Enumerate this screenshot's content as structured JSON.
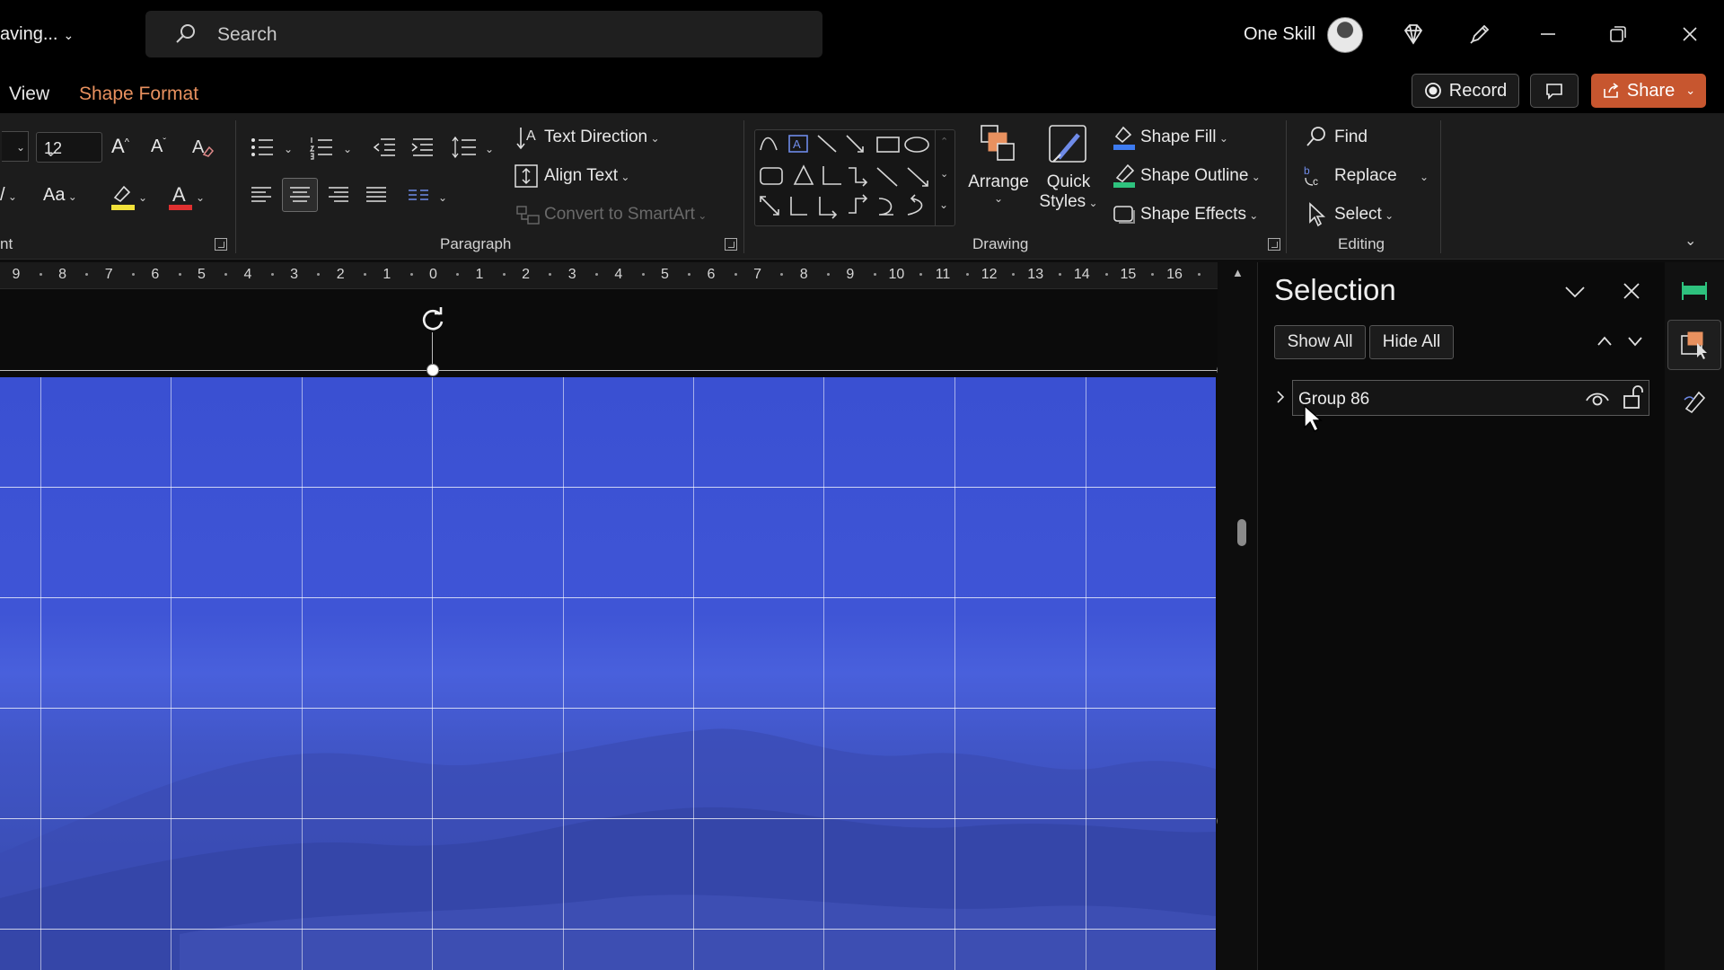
{
  "titlebar": {
    "doc_title": "aving...",
    "search_placeholder": "Search",
    "user_name": "One Skill",
    "icons": [
      "chevron-down-icon",
      "search-icon",
      "avatar",
      "diamond-icon",
      "pen-icon",
      "minimize-icon",
      "restore-icon",
      "close-icon"
    ]
  },
  "tabs": [
    {
      "label": "View",
      "active": false
    },
    {
      "label": "Shape Format",
      "active": true
    }
  ],
  "actions": {
    "record_label": "Record",
    "share_label": "Share"
  },
  "ribbon": {
    "font": {
      "group_label": "nt",
      "font_size": "12"
    },
    "paragraph": {
      "group_label": "Paragraph",
      "text_direction": "Text Direction",
      "align_text": "Align Text",
      "convert_smartart": "Convert to SmartArt"
    },
    "drawing": {
      "group_label": "Drawing",
      "arrange": "Arrange",
      "quick_styles_1": "Quick",
      "quick_styles_2": "Styles",
      "shape_fill": "Shape Fill",
      "shape_outline": "Shape Outline",
      "shape_effects": "Shape Effects"
    },
    "editing": {
      "group_label": "Editing",
      "find": "Find",
      "replace": "Replace",
      "select": "Select"
    },
    "colors": {
      "highlight": "#f2e23a",
      "font_color": "#e03030",
      "accent": "#e8915f",
      "shape_fill": "#3d7bf0",
      "shape_outline": "#2ec27e"
    }
  },
  "ruler": {
    "labels": [
      "9",
      "8",
      "7",
      "6",
      "5",
      "4",
      "3",
      "2",
      "1",
      "0",
      "1",
      "2",
      "3",
      "4",
      "5",
      "6",
      "7",
      "8",
      "9",
      "10",
      "11",
      "12",
      "13",
      "14",
      "15",
      "16"
    ]
  },
  "slide": {
    "background": "#3f55d6",
    "grid_color": "#ffffff"
  },
  "selection_pane": {
    "title": "Selection",
    "show_all": "Show All",
    "hide_all": "Hide All",
    "items": [
      {
        "name": "Group 86",
        "visible": true,
        "locked": false
      }
    ]
  }
}
